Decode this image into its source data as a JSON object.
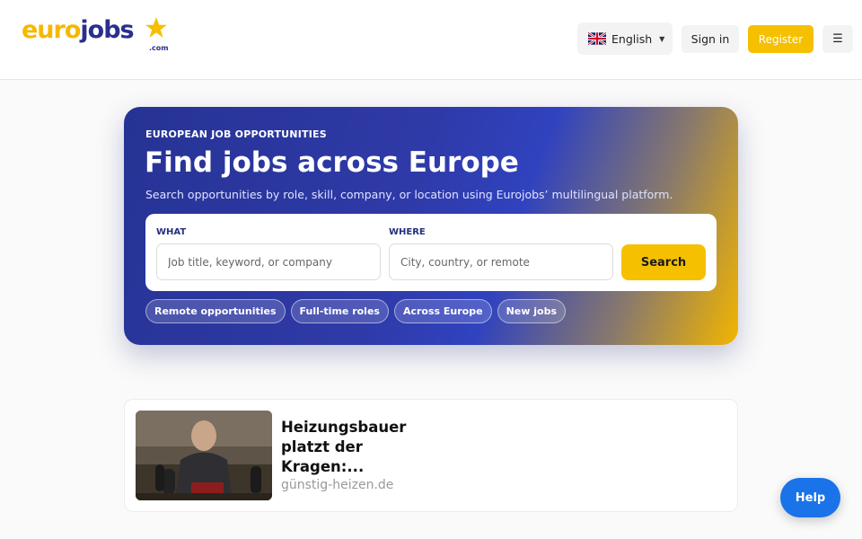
{
  "header": {
    "logo": {
      "part1": "euro",
      "part2": "jobs",
      "suffix": ".com"
    },
    "language": {
      "label": "English",
      "flag": "uk-flag-icon"
    },
    "signin_label": "Sign in",
    "register_label": "Register",
    "menu_icon": "☰"
  },
  "hero": {
    "eyebrow": "EUROPEAN JOB OPPORTUNITIES",
    "title": "Find jobs across Europe",
    "subtitle": "Search opportunities by role, skill, company, or location using Eurojobs’ multilingual platform.",
    "what_label": "WHAT",
    "what_placeholder": "Job title, keyword, or company",
    "where_label": "WHERE",
    "where_placeholder": "City, country, or remote",
    "search_label": "Search",
    "chips": [
      "Remote opportunities",
      "Full-time roles",
      "Across Europe",
      "New jobs"
    ]
  },
  "ad": {
    "title": "Heizungsbauer platzt der Kragen:...",
    "domain": "günstig-heizen.de"
  },
  "help_label": "Help",
  "colors": {
    "brand_yellow": "#f5c000",
    "brand_navy": "#2a2f8c",
    "help_blue": "#1a73e8"
  }
}
